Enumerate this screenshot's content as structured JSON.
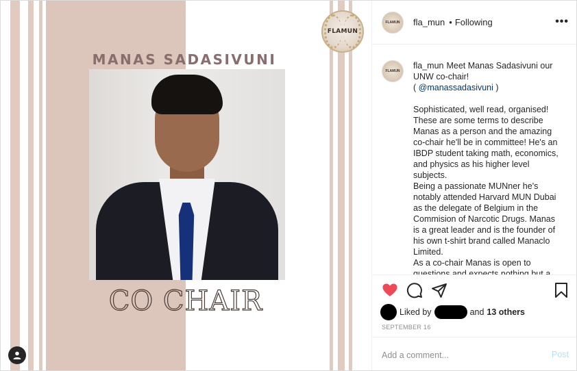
{
  "post_image": {
    "logo_text": "FLAMUN",
    "name": "MANAS SADASIVUNI",
    "role": "CO CHAIR",
    "colors": {
      "panel": "#dcc5ba",
      "stripe": "#e1cbc0",
      "name_text": "#8a6d6d"
    }
  },
  "header": {
    "username": "fla_mun",
    "separator": "•",
    "follow_status": "Following",
    "more_label": "•••",
    "avatar_text": "FLAMUN"
  },
  "caption": {
    "username": "fla_mun",
    "intro": "Meet Manas Sadasivuni our UNW co-chair!",
    "mention_open": "( ",
    "mention": "@manassadasivuni",
    "mention_close": " )",
    "paragraph1": "Sophisticated, well read, organised! These are some terms to describe Manas as a person and the amazing co-chair he'll be in committee! He's an IBDP student taking math, economics, and physics as his higher level subjects.",
    "paragraph2": "Being a passionate MUNner he's notably attended Harvard MUN Dubai as the delegate of Belgium in the Commision of Narcotic Drugs. Manas is a great leader and is the founder of his own t-shirt brand called Manaclo Limited.",
    "paragraph3": "As a co-chair Manas is open to questions and expects nothing but a"
  },
  "actions": {
    "like_icon": "heart-icon",
    "comment_icon": "comment-icon",
    "share_icon": "paper-plane-icon",
    "save_icon": "bookmark-icon",
    "like_color": "#ed4956"
  },
  "likes": {
    "prefix": "Liked by",
    "and": "and",
    "others": "13 others"
  },
  "date": "SEPTEMBER 16",
  "comment": {
    "placeholder": "Add a comment...",
    "post_label": "Post"
  }
}
